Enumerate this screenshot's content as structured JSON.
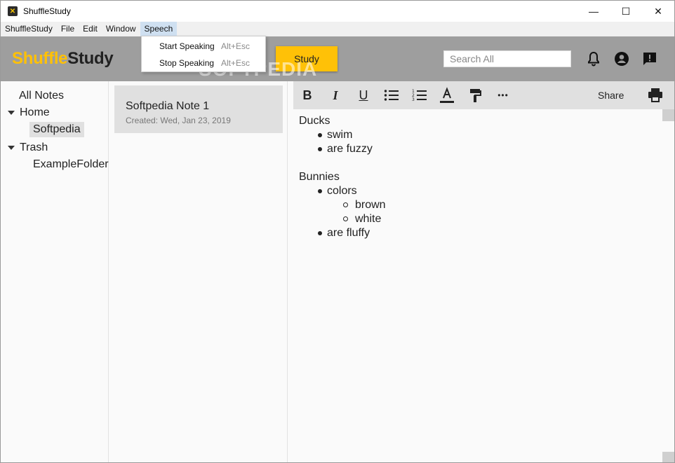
{
  "window": {
    "title": "ShuffleStudy",
    "minimize": "—",
    "maximize": "☐",
    "close": "✕"
  },
  "menubar": {
    "items": [
      "ShuffleStudy",
      "File",
      "Edit",
      "Window",
      "Speech"
    ]
  },
  "speech_menu": {
    "items": [
      {
        "label": "Start Speaking",
        "shortcut": "Alt+Esc"
      },
      {
        "label": "Stop Speaking",
        "shortcut": "Alt+Esc"
      }
    ]
  },
  "header": {
    "logo_part1": "Shuffle",
    "logo_part2": "Study",
    "study_button": "Study",
    "search_placeholder": "Search All",
    "icons": [
      "bell-icon",
      "account-icon",
      "feedback-icon"
    ]
  },
  "watermark": "SOFTPEDIA",
  "sidebar": {
    "all_notes": "All Notes",
    "home": "Home",
    "home_child": "Softpedia",
    "trash": "Trash",
    "trash_child": "ExampleFolder"
  },
  "notes": [
    {
      "title": "Softpedia Note 1",
      "created": "Created: Wed, Jan 23, 2019"
    }
  ],
  "toolbar": {
    "bold": "B",
    "italic": "I",
    "underline": "U",
    "share": "Share",
    "more": "•••"
  },
  "editor": {
    "heading1": "Ducks",
    "ducks_items": [
      "swim",
      "are fuzzy"
    ],
    "heading2": "Bunnies",
    "bunnies_item1": "colors",
    "colors_items": [
      "brown",
      "white"
    ],
    "bunnies_item2": "are fluffy"
  },
  "colors": {
    "accent": "#ffc107",
    "header_bg": "#9e9e9e",
    "toolbar_bg": "#e0e0e0"
  }
}
